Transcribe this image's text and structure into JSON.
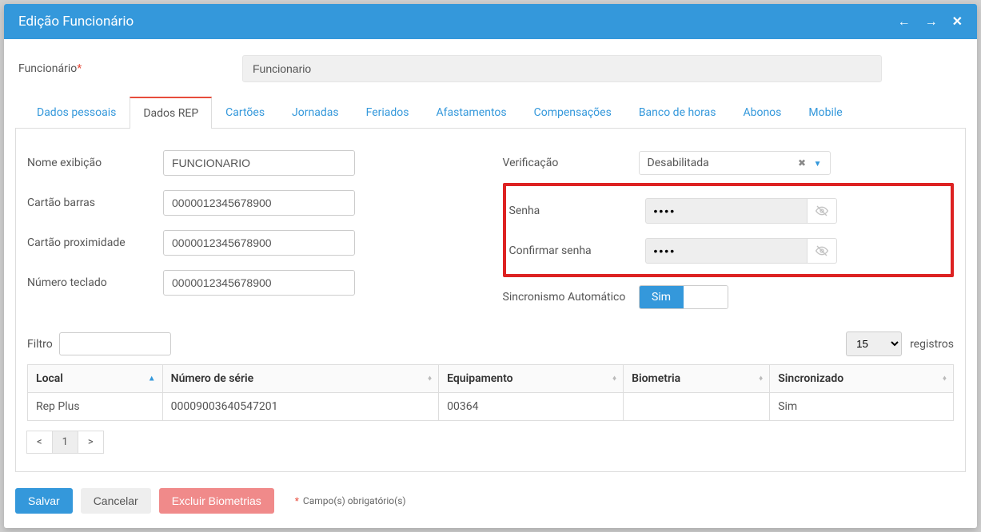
{
  "header": {
    "title": "Edição Funcionário"
  },
  "top": {
    "label": "Funcionário",
    "value": "Funcionario"
  },
  "tabs": [
    "Dados pessoais",
    "Dados REP",
    "Cartões",
    "Jornadas",
    "Feriados",
    "Afastamentos",
    "Compensações",
    "Banco de horas",
    "Abonos",
    "Mobile"
  ],
  "active_tab_index": 1,
  "form": {
    "left": {
      "nome_exibicao": {
        "label": "Nome exibição",
        "value": "FUNCIONARIO"
      },
      "cartao_barras": {
        "label": "Cartão barras",
        "value": "0000012345678900"
      },
      "cartao_prox": {
        "label": "Cartão proximidade",
        "value": "0000012345678900"
      },
      "num_teclado": {
        "label": "Número teclado",
        "value": "0000012345678900"
      }
    },
    "right": {
      "verificacao": {
        "label": "Verificação",
        "value": "Desabilitada"
      },
      "senha": {
        "label": "Senha",
        "value": "••••"
      },
      "confirmar_senha": {
        "label": "Confirmar senha",
        "value": "••••"
      },
      "sincronismo": {
        "label": "Sincronismo Automático",
        "value": "Sim"
      }
    }
  },
  "filter": {
    "label": "Filtro",
    "page_size": "15",
    "records_label": "registros"
  },
  "table": {
    "columns": [
      "Local",
      "Número de série",
      "Equipamento",
      "Biometria",
      "Sincronizado"
    ],
    "rows": [
      {
        "local": "Rep Plus",
        "serie": "00009003640547201",
        "equip": "00364",
        "bio": "",
        "sync": "Sim"
      }
    ]
  },
  "pagination": {
    "prev": "<",
    "page": "1",
    "next": ">"
  },
  "footer": {
    "save": "Salvar",
    "cancel": "Cancelar",
    "excluir": "Excluir Biometrias",
    "req_note": "Campo(s) obrigatório(s)"
  }
}
